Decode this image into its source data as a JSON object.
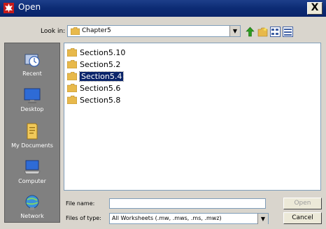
{
  "window": {
    "title": "Open",
    "close_label": "X"
  },
  "lookin": {
    "label": "Look in:",
    "value": "Chapter5"
  },
  "places": [
    {
      "label": "Recent",
      "icon": "recent-icon"
    },
    {
      "label": "Desktop",
      "icon": "desktop-icon"
    },
    {
      "label": "My Documents",
      "icon": "my-documents-icon"
    },
    {
      "label": "Computer",
      "icon": "computer-icon"
    },
    {
      "label": "Network",
      "icon": "network-icon"
    }
  ],
  "files": [
    {
      "name": "Section5.10",
      "selected": false
    },
    {
      "name": "Section5.2",
      "selected": false
    },
    {
      "name": "Section5.4",
      "selected": true
    },
    {
      "name": "Section5.6",
      "selected": false
    },
    {
      "name": "Section5.8",
      "selected": false
    }
  ],
  "form": {
    "filename_label": "File name:",
    "filename_value": "",
    "filetype_label": "Files of type:",
    "filetype_value": "All Worksheets (.mw, .mws, .ms, .mwz)"
  },
  "buttons": {
    "open": "Open",
    "cancel": "Cancel"
  },
  "colors": {
    "titlebar": "#0c2b74",
    "places_background": "#808080",
    "selection": "#0a246a",
    "folder": "#e8b94b"
  }
}
